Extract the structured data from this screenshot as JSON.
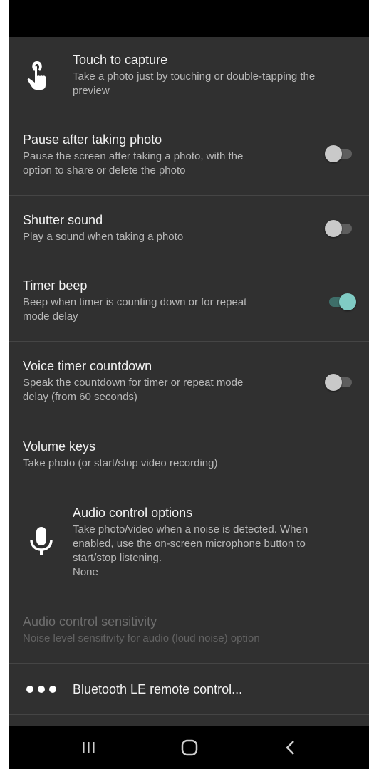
{
  "settings": {
    "touch_to_capture": {
      "icon": "touch-icon",
      "title": "Touch to capture",
      "summary_line1": "Take a photo just by touching or double-tapping the",
      "summary_line2": "preview"
    },
    "pause_after_photo": {
      "title": "Pause after taking photo",
      "summary_line1": "Pause the screen after taking a photo, with the",
      "summary_line2": "option to share or delete the photo",
      "enabled": false
    },
    "shutter_sound": {
      "title": "Shutter sound",
      "summary_line1": "Play a sound when taking a photo",
      "enabled": false
    },
    "timer_beep": {
      "title": "Timer beep",
      "summary_line1": "Beep when timer is counting down or for repeat",
      "summary_line2": "mode delay",
      "enabled": true
    },
    "voice_timer_countdown": {
      "title": "Voice timer countdown",
      "summary_line1": "Speak the countdown for timer or repeat mode",
      "summary_line2": "delay (from 60 seconds)",
      "enabled": false
    },
    "volume_keys": {
      "title": "Volume keys",
      "summary_line1": "Take photo (or start/stop video recording)"
    },
    "audio_control_options": {
      "icon": "microphone-icon",
      "title": "Audio control options",
      "summary_line1": "Take photo/video when a noise is detected. When",
      "summary_line2": "enabled, use the on-screen microphone button to",
      "summary_line3": "start/stop listening.",
      "value": "None"
    },
    "audio_control_sensitivity": {
      "title": "Audio control sensitivity",
      "summary_line1": "Noise level sensitivity for audio (loud noise) option",
      "disabled": true
    },
    "bluetooth_remote": {
      "icon": "more-dots-icon",
      "title": "Bluetooth LE remote control..."
    }
  },
  "navigation": {
    "recents": "recents-icon",
    "home": "home-icon",
    "back": "back-icon"
  },
  "colors": {
    "background": "#303030",
    "switch_on_thumb": "#80cbc4",
    "switch_on_track": "#3e6e69",
    "switch_off_thumb": "#c9c9c9"
  }
}
